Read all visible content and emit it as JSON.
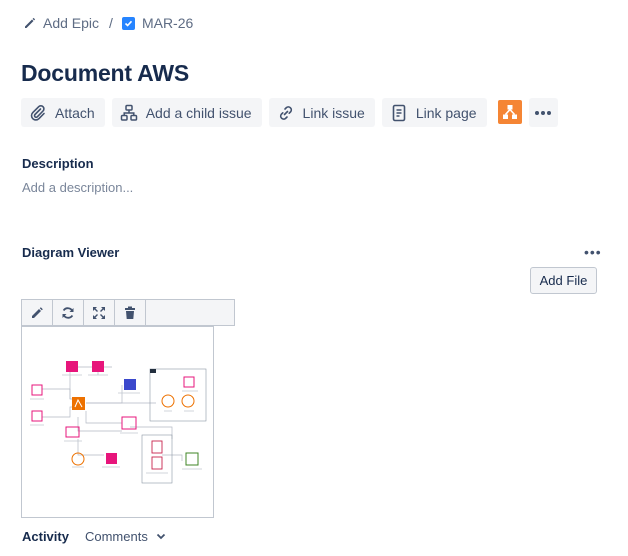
{
  "breadcrumb": {
    "parent_label": "Add Epic",
    "separator": "/",
    "issue_key": "MAR-26"
  },
  "issue": {
    "title": "Document AWS"
  },
  "toolbar": {
    "attach": "Attach",
    "add_child": "Add a child issue",
    "link_issue": "Link issue",
    "link_page": "Link page",
    "drawio_icon": "drawio-app-icon",
    "more_icon": "more-icon"
  },
  "description": {
    "label": "Description",
    "placeholder": "Add a description..."
  },
  "diagram_viewer": {
    "label": "Diagram Viewer",
    "more": "•••",
    "add_file": "Add File",
    "tools": [
      "edit-icon",
      "refresh-icon",
      "fullscreen-icon",
      "delete-icon"
    ]
  },
  "activity": {
    "label": "Activity",
    "filter": "Comments"
  },
  "colors": {
    "accent_blue": "#2684ff",
    "drawio_orange": "#f58534",
    "aws_pink": "#e7157b",
    "aws_orange": "#ed7100",
    "aws_purple": "#3b48cc",
    "aws_green": "#3f8624"
  }
}
